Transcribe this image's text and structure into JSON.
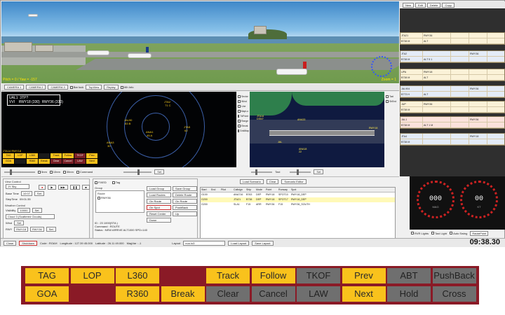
{
  "view3d": {
    "hud_text": "Pitch = 0 / Yaw = -157",
    "zoom_text": "Zoom = 1",
    "plane_tag": "JTA"
  },
  "toolbar3d": {
    "camera_labels": [
      "CAMERA 1",
      "CAMERA 2",
      "CAMERA 3"
    ],
    "check_label": "Bar lock",
    "btn_labels": [
      "TopView",
      "Replay"
    ],
    "check2_label": "Wh Info"
  },
  "radar": {
    "info_box": "UAL1  3TP?\nVVI    RWY18 (330)  RWY36 (330)",
    "header": "JTA14  RWY18",
    "targets": [
      {
        "text": "JTA2\n 71 C"
      },
      {
        "text": "JAL90\n 83 B"
      },
      {
        "text": "ANA1\n 45 A"
      },
      {
        "text": "JTA5\n 62"
      },
      {
        "text": "ANA3\n 30"
      }
    ],
    "side_checks": [
      "Sector",
      "Wind",
      "Line",
      "MapLo",
      "TdPoint",
      "Range",
      "Elevat",
      "GridMap"
    ]
  },
  "gmap": {
    "labels": [
      "JTA14\nDSN?",
      "ANA33",
      "RWY18",
      "JAL",
      "ANA18\n22"
    ],
    "side_checks": [
      "Taxi",
      "ShEnd"
    ]
  },
  "sliders": {
    "options": [
      "5nm",
      "10nm",
      "30nm",
      "Command"
    ],
    "set_label": "Set",
    "taxi_label": "Taxi"
  },
  "strips": {
    "toolbar": [
      "New",
      "Edit",
      "Delete",
      "Copy"
    ],
    "items": [
      {
        "rows": [
          [
            "JTA21",
            "RWY36",
            "",
            "",
            ""
          ],
          [
            "B738 M",
            "ALT",
            "",
            "",
            ""
          ]
        ]
      },
      {
        "rows": [
          [
            "JTA2",
            "",
            "",
            "RWY36",
            ""
          ],
          [
            "B738 M",
            "ALT 5 1",
            "",
            "",
            ""
          ]
        ]
      },
      {
        "rows": [
          [
            "UPA",
            "RWY18",
            "",
            "",
            ""
          ],
          [
            "B738 M",
            "ALT",
            "",
            "",
            ""
          ]
        ]
      },
      {
        "rows": [
          [
            "JAL904",
            "",
            "",
            "RWY36",
            ""
          ],
          [
            "B773 H",
            "ALT",
            "",
            "",
            ""
          ]
        ]
      },
      {
        "rows": [
          [
            "JUP",
            "RWY36",
            "",
            "",
            ""
          ],
          [
            "B738 M",
            "",
            "",
            "",
            ""
          ]
        ]
      },
      {
        "rows": [
          [
            "JAL1",
            "",
            "",
            "RWY36",
            ""
          ],
          [
            "B738 M",
            "ALT 1 M",
            "",
            "",
            ""
          ]
        ]
      },
      {
        "rows": [
          [
            "JTA4",
            "",
            "",
            "RWY18",
            ""
          ],
          [
            "B738 M",
            "",
            "",
            "",
            ""
          ]
        ]
      }
    ]
  },
  "ctrl": {
    "view_control": "View Control",
    "view_field": "JY Sky",
    "base_time_label": "Base Time",
    "base_time": "10:07",
    "set_label": "Set",
    "step_time_label": "StepTime",
    "step_time": "09:01:35",
    "weather_label": "Weather Control",
    "visibility_label": "Visibility",
    "visibility": "10000",
    "cloud": "Cloud 3 (Scattered Clouds)",
    "wind_label": "Wind",
    "rwy_label": "RWY",
    "rwy_field": "RWY18",
    "rwy2_field": "RWY36",
    "fix_label": "FIXED",
    "tag_label": "Tag",
    "route_label": "Route",
    "route_item": "RWY36",
    "group_label": "Group",
    "lower_lines": [
      "ID : 23   1000(STA )",
      "Command : ROUTE",
      "Status : NEW ARRIVE ALT1000 SPD=140"
    ],
    "mid_btns": [
      "Load Group",
      "Save Group",
      "Load Routes",
      "Delete Route",
      "On Route",
      "On Route",
      "On Spot",
      "PushBack",
      "Reset Center",
      "Up",
      "Down"
    ],
    "scn_btns": [
      "Load Scenario",
      "Clear",
      "Scenario Editor"
    ],
    "table_headers": [
      "Start",
      "End",
      "Pilot",
      "Callsign",
      "Ship",
      "Mode",
      "Point",
      "Runway",
      "Spot",
      "Route"
    ],
    "table_rows": [
      [
        "G100",
        "",
        "",
        "ANA716",
        "B763",
        "DEP",
        "RWY18",
        "SPOT10",
        "RWY18_DEP"
      ],
      [
        "G200",
        "",
        "",
        "JTA21",
        "B738",
        "DEP",
        "RWY18",
        "SPOT17",
        "RWY18_DEP"
      ],
      [
        "G200",
        "",
        "",
        "SLA1",
        "F15",
        "ARR",
        "RWY36",
        "F15",
        "RWY36_SOUTH"
      ]
    ]
  },
  "gauges": {
    "left_value": "000",
    "left_unit": "MAG",
    "right_value": "00",
    "right_unit": "KT",
    "opts": [
      "RVR Lights",
      "Taxi Light",
      "Auto Swing"
    ],
    "select": "RadarPoint"
  },
  "status": {
    "buttons": [
      "Close",
      "Shutdown"
    ],
    "code": "Code : ROAH",
    "longitude": "Longitude : 127.39  45.000",
    "latitude": "Latitude : 26.11  49.000",
    "magvar": "MagVar : -1",
    "layout_label": "Layout",
    "layout_field": "nuo.lo3",
    "load_layout": "Load Layout",
    "save_layout": "Save Layout",
    "clock": "09:38.30"
  },
  "commands": {
    "colors": {
      "yellow": "#f9c21c",
      "gray": "#6f6f6f",
      "frame": "#8a1a26"
    },
    "row1": [
      {
        "label": "TAG",
        "style": "y"
      },
      {
        "label": "LOP",
        "style": "y"
      },
      {
        "label": "L360",
        "style": "y"
      },
      {
        "label": "",
        "style": "e"
      },
      {
        "label": "Track",
        "style": "y"
      },
      {
        "label": "Follow",
        "style": "y"
      },
      {
        "label": "TKOF",
        "style": "g"
      },
      {
        "label": "Prev",
        "style": "y"
      },
      {
        "label": "ABT",
        "style": "g"
      },
      {
        "label": "PushBack",
        "style": "g"
      }
    ],
    "row2": [
      {
        "label": "GOA",
        "style": "y"
      },
      {
        "label": "",
        "style": "e"
      },
      {
        "label": "R360",
        "style": "y"
      },
      {
        "label": "Break",
        "style": "y"
      },
      {
        "label": "Clear",
        "style": "g"
      },
      {
        "label": "Cancel",
        "style": "g"
      },
      {
        "label": "LAW",
        "style": "g"
      },
      {
        "label": "Next",
        "style": "y"
      },
      {
        "label": "Hold",
        "style": "g"
      },
      {
        "label": "Cross",
        "style": "g"
      }
    ]
  }
}
